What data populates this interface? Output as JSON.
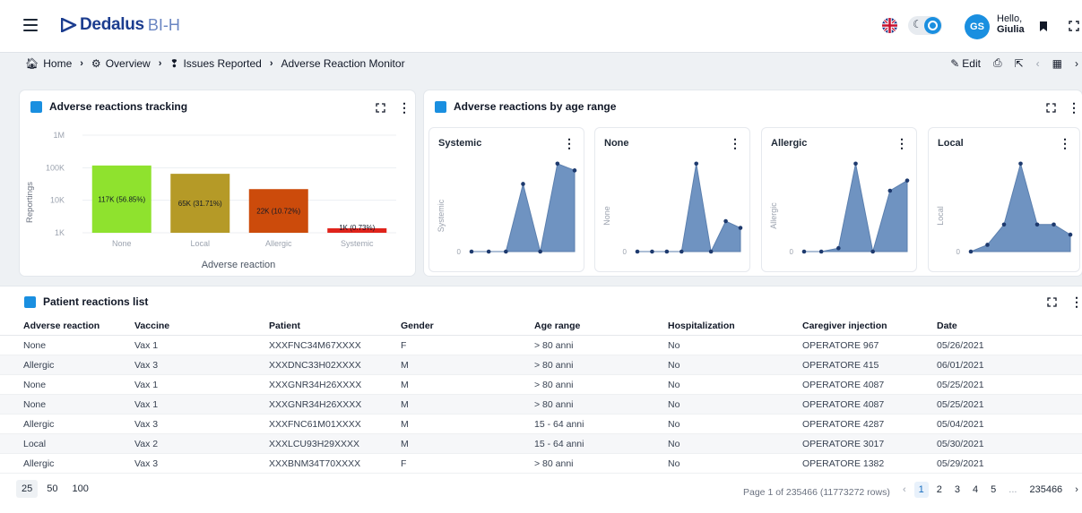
{
  "header": {
    "logo_text": "Dedalus",
    "logo_suffix": "BI-H",
    "greeting": "Hello,",
    "user_name": "Giulia",
    "avatar_initials": "GS"
  },
  "breadcrumb": [
    "Home",
    "Overview",
    "Issues Reported",
    "Adverse Reaction Monitor"
  ],
  "actions": {
    "edit_label": "Edit"
  },
  "tracking_card": {
    "title": "Adverse reactions tracking",
    "chart_data": {
      "type": "bar",
      "title": "",
      "ylabel": "Reportings",
      "xlabel": "Adverse reaction",
      "yscale": "log",
      "ytick_labels": [
        "1M",
        "100K",
        "10K",
        "1K"
      ],
      "categories": [
        "None",
        "Local",
        "Allergic",
        "Systemic"
      ],
      "values": [
        117000,
        65000,
        22000,
        1000
      ],
      "value_labels": [
        "117K (56.85%)",
        "65K (31.71%)",
        "22K (10.72%)",
        "1K (0.73%)"
      ],
      "colors": [
        "#8fe22e",
        "#b59a27",
        "#cc4b0b",
        "#e0231b"
      ],
      "grid": true
    }
  },
  "age_card": {
    "title": "Adverse reactions by age range",
    "chart_data": [
      {
        "type": "area",
        "title": "Systemic",
        "ylabel": "Systemic",
        "ytick_labels": [
          "0"
        ],
        "values": [
          0,
          0,
          0,
          2,
          0,
          2.6,
          2.4
        ],
        "color": "#6f93c1"
      },
      {
        "type": "area",
        "title": "None",
        "ylabel": "None",
        "ytick_labels": [
          "0"
        ],
        "values": [
          0,
          0,
          0,
          0,
          2.6,
          0,
          0.9,
          0.7
        ],
        "color": "#6f93c1"
      },
      {
        "type": "area",
        "title": "Allergic",
        "ylabel": "Allergic",
        "ytick_labels": [
          "0"
        ],
        "values": [
          0,
          0,
          0.1,
          2.6,
          0,
          1.8,
          2.1
        ],
        "color": "#6f93c1"
      },
      {
        "type": "area",
        "title": "Local",
        "ylabel": "Local",
        "ytick_labels": [
          "0"
        ],
        "values": [
          0,
          0.2,
          0.8,
          2.6,
          0.8,
          0.8,
          0.5
        ],
        "color": "#6f93c1"
      }
    ]
  },
  "list_card": {
    "title": "Patient reactions list",
    "columns": [
      "Adverse reaction",
      "Vaccine",
      "Patient",
      "Gender",
      "Age range",
      "Hospitalization",
      "Caregiver injection",
      "Date"
    ],
    "rows": [
      [
        "None",
        "Vax 1",
        "XXXFNC34M67XXXX",
        "F",
        "> 80 anni",
        "No",
        "OPERATORE 967",
        "05/26/2021"
      ],
      [
        "Allergic",
        "Vax 3",
        "XXXDNC33H02XXXX",
        "M",
        "> 80 anni",
        "No",
        "OPERATORE 415",
        "06/01/2021"
      ],
      [
        "None",
        "Vax 1",
        "XXXGNR34H26XXXX",
        "M",
        "> 80 anni",
        "No",
        "OPERATORE 4087",
        "05/25/2021"
      ],
      [
        "None",
        "Vax 1",
        "XXXGNR34H26XXXX",
        "M",
        "> 80 anni",
        "No",
        "OPERATORE 4087",
        "05/25/2021"
      ],
      [
        "Allergic",
        "Vax 3",
        "XXXFNC61M01XXXX",
        "M",
        "15 - 64 anni",
        "No",
        "OPERATORE 4287",
        "05/04/2021"
      ],
      [
        "Local",
        "Vax 2",
        "XXXLCU93H29XXXX",
        "M",
        "15 - 64 anni",
        "No",
        "OPERATORE 3017",
        "05/30/2021"
      ],
      [
        "Allergic",
        "Vax 3",
        "XXXBNM34T70XXXX",
        "F",
        "> 80 anni",
        "No",
        "OPERATORE 1382",
        "05/29/2021"
      ]
    ],
    "page_sizes": [
      "25",
      "50",
      "100"
    ],
    "page_info": "Page 1 of 235466 (11773272 rows)",
    "pages": [
      "1",
      "2",
      "3",
      "4",
      "5",
      "...",
      "235466"
    ]
  }
}
